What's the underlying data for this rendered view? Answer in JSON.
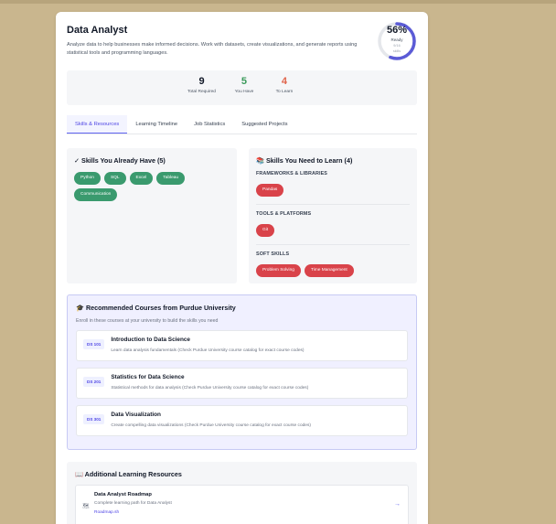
{
  "header": {
    "title": "Data Analyst",
    "description": "Analyze data to help businesses make informed decisions. Work with datasets, create visualizations, and generate reports using statistical tools and programming languages."
  },
  "readiness": {
    "percent": 56,
    "percent_label": "56%",
    "label": "Ready",
    "sub1": "9/16",
    "sub2": "skills",
    "color": "#5b5bd6",
    "track": "#e5e7eb"
  },
  "stats": [
    {
      "value": "9",
      "label": "Total Required",
      "color": "#111827"
    },
    {
      "value": "5",
      "label": "You Have",
      "color": "#3a9a5a"
    },
    {
      "value": "4",
      "label": "To Learn",
      "color": "#e0634a"
    }
  ],
  "tabs": [
    "Skills & Resources",
    "Learning Timeline",
    "Job Statistics",
    "Suggested Projects"
  ],
  "have": {
    "title": "✓ Skills You Already Have (5)",
    "skills": [
      "Python",
      "SQL",
      "Excel",
      "Tableau",
      "Communication"
    ]
  },
  "learn": {
    "title": "📚 Skills You Need to Learn (4)",
    "categories": [
      {
        "name": "FRAMEWORKS & LIBRARIES",
        "skills": [
          "Pandas"
        ]
      },
      {
        "name": "TOOLS & PLATFORMS",
        "skills": [
          "Git"
        ]
      },
      {
        "name": "SOFT SKILLS",
        "skills": [
          "Problem Solving",
          "Time Management"
        ]
      }
    ]
  },
  "courses": {
    "title": "🎓 Recommended Courses from Purdue University",
    "subtitle": "Enroll in these courses at your university to build the skills you need",
    "items": [
      {
        "code": "DS 101",
        "name": "Introduction to Data Science",
        "desc": "Learn data analysis fundamentals (Check Purdue University course catalog for exact course codes)"
      },
      {
        "code": "DS 201",
        "name": "Statistics for Data Science",
        "desc": "Statistical methods for data analysis (Check Purdue University course catalog for exact course codes)"
      },
      {
        "code": "DS 301",
        "name": "Data Visualization",
        "desc": "Create compelling data visualizations (Check Purdue University course catalog for exact course codes)"
      }
    ]
  },
  "additional": {
    "title": "📖 Additional Learning Resources",
    "items": [
      {
        "name": "Data Analyst Roadmap",
        "desc": "Complete learning path for Data Analyst",
        "link": "Roadmap.sh",
        "icon": "🗺",
        "arrow": "→"
      }
    ]
  }
}
